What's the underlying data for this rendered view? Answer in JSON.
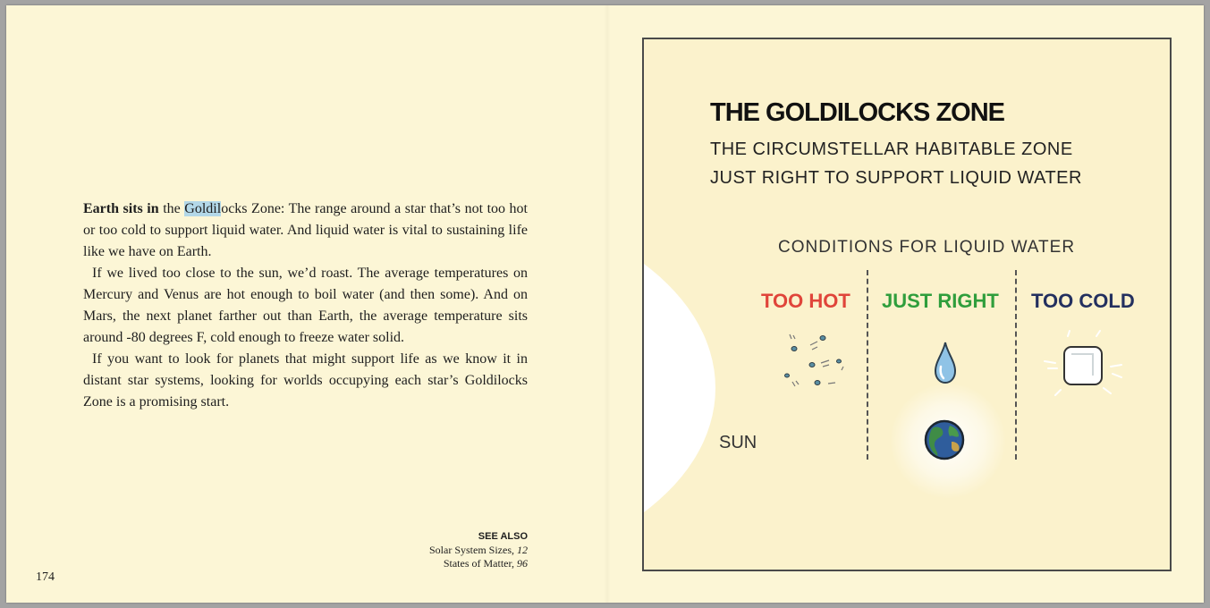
{
  "left_page": {
    "lead_bold": "Earth sits in",
    "p1_a": " the ",
    "p1_highlight": "Goldil",
    "p1_b": "ocks Zone: The range around a star that’s not too hot or too cold to support liquid water. And liquid water is vital to sustaining life like we have on Earth.",
    "p2": "If we lived too close to the sun, we’d roast. The average temperatures on Mercury and Venus are hot enough to boil water (and then some). And on Mars, the next planet farther out than Earth, the average temperature sits around -80 degrees F, cold enough to freeze water solid.",
    "p3": "If you want to look for planets that might support life as we know it in distant star systems, looking for worlds occupying each star’s Goldilocks Zone is a promising start.",
    "highlight_color": "#b3d8e8",
    "see_also": {
      "heading": "SEE ALSO",
      "items": [
        {
          "title": "Solar System Sizes,",
          "page": "12"
        },
        {
          "title": "States of Matter,",
          "page": "96"
        }
      ]
    },
    "page_number": "174"
  },
  "illustration": {
    "title": "The Goldilocks Zone",
    "subtitle_1": "The circumstellar habitable zone",
    "subtitle_2": "Just right to support liquid water",
    "conditions_heading": "Conditions for liquid water",
    "zones": [
      {
        "label": "Too hot",
        "color": "#e0453a",
        "icon": "steam-icon"
      },
      {
        "label": "Just right",
        "color": "#2f9e3c",
        "icon": "water-drop-icon"
      },
      {
        "label": "Too cold",
        "color": "#23305f",
        "icon": "ice-cube-icon"
      }
    ],
    "sun_label": "Sun",
    "planet_icon": "earth-icon"
  }
}
